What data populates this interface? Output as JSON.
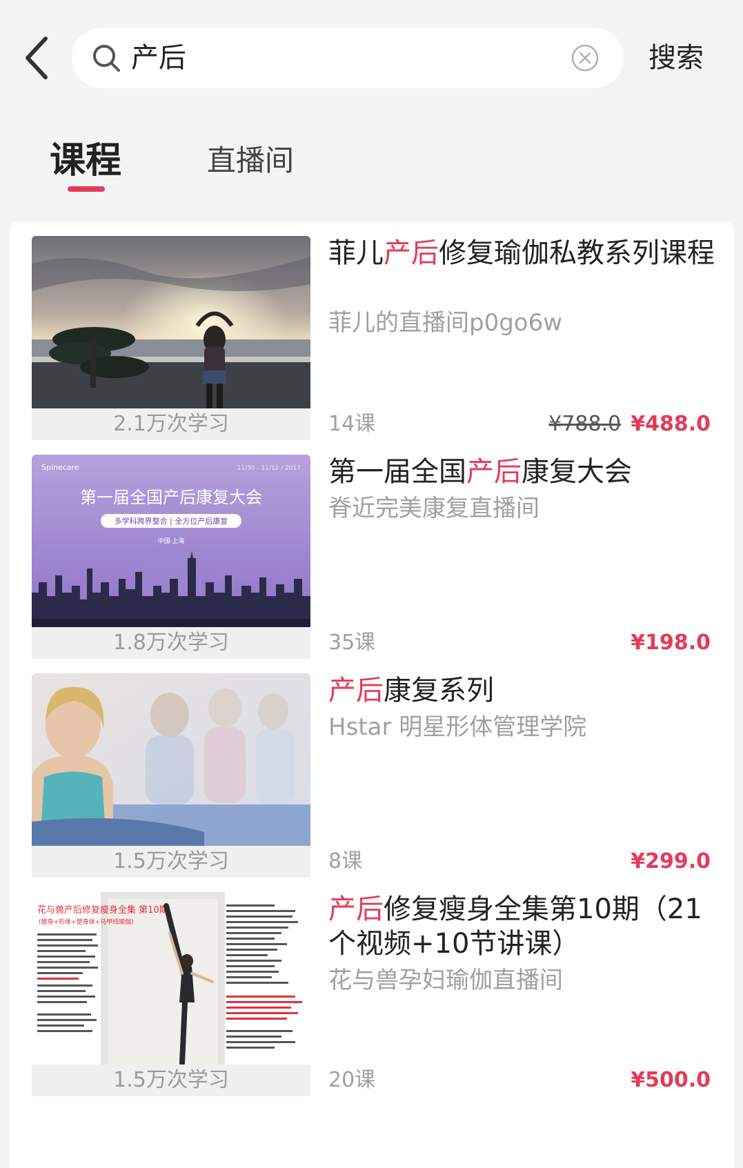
{
  "search": {
    "query": "产后",
    "button_label": "搜索"
  },
  "tabs": [
    {
      "label": "课程",
      "active": true
    },
    {
      "label": "直播间",
      "active": false
    }
  ],
  "courses": [
    {
      "title_pre": "菲儿",
      "title_hl": "产后",
      "title_post": "修复瑜伽私教系列课程",
      "author": "菲儿的直播间p0go6w",
      "views": "2.1万次学习",
      "lessons": "14课",
      "original_price": "¥788.0",
      "price": "¥488.0"
    },
    {
      "title_pre": "第一届全国",
      "title_hl": "产后",
      "title_post": "康复大会",
      "author": "脊近完美康复直播间",
      "views": "1.8万次学习",
      "lessons": "35课",
      "original_price": "",
      "price": "¥198.0",
      "poster": {
        "brand": "Spinecare",
        "date": "11/30 - 11/12 / 2017",
        "headline": "第一届全国产后康复大会",
        "tagline": "多学科跨界整合 | 全方位产后康复",
        "place": "中国·上海"
      }
    },
    {
      "title_pre": "",
      "title_hl": "产后",
      "title_post": "康复系列",
      "author": "Hstar 明星形体管理学院",
      "views": "1.5万次学习",
      "lessons": "8课",
      "original_price": "",
      "price": "¥299.0"
    },
    {
      "title_pre": "",
      "title_hl": "产后",
      "title_post": "修复瘦身全集第10期（21个视频+10节讲课）",
      "author": "花与兽孕妇瑜伽直播间",
      "views": "1.5万次学习",
      "lessons": "20课",
      "original_price": "",
      "price": "¥500.0",
      "poster": {
        "headline": "花与兽产后修复瘦身全集 第10期",
        "subline": "(瘦身+形体+塑身体+马甲线瑜伽)"
      }
    }
  ],
  "colors": {
    "accent": "#e53a5b",
    "background": "#f4f4f5"
  }
}
